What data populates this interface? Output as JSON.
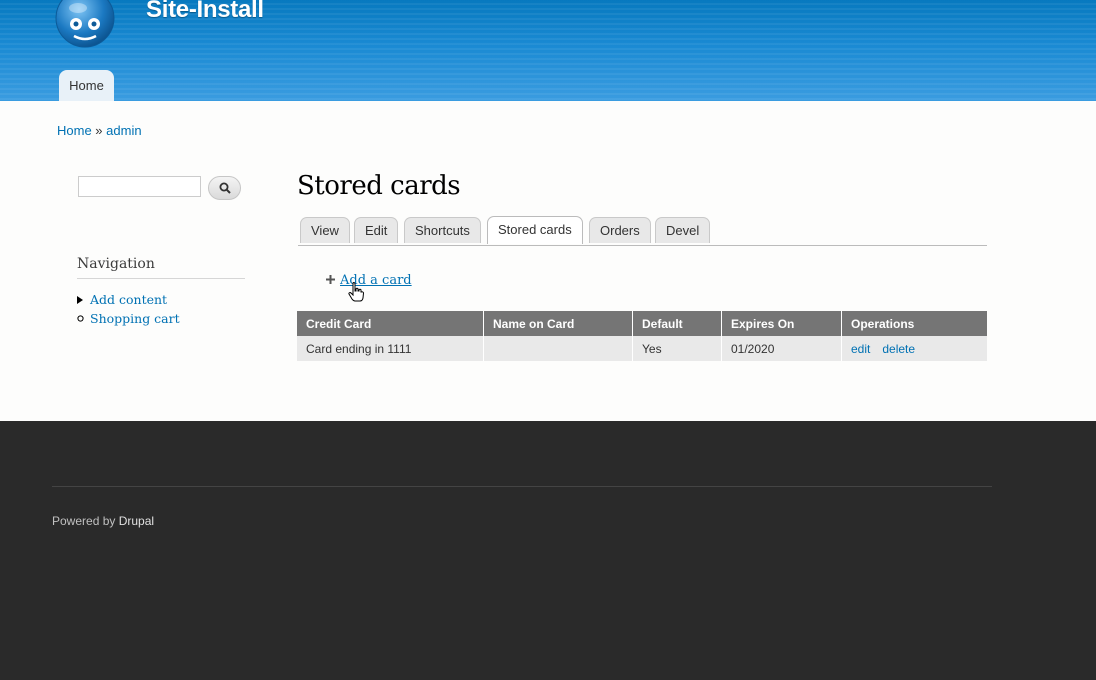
{
  "header": {
    "site_name": "Site-Install",
    "logo_icon": "drupal-drop-icon",
    "menu": [
      {
        "label": "Home"
      }
    ]
  },
  "breadcrumb": {
    "home": "Home",
    "separator": " » ",
    "current": "admin"
  },
  "sidebar": {
    "search": {
      "value": "",
      "button_icon": "search-icon"
    },
    "navigation": {
      "title": "Navigation",
      "items": [
        {
          "label": "Add content",
          "marker": "triangle-right"
        },
        {
          "label": "Shopping cart",
          "marker": "circle"
        }
      ]
    }
  },
  "main": {
    "title": "Stored cards",
    "tabs": [
      {
        "label": "View"
      },
      {
        "label": "Edit"
      },
      {
        "label": "Shortcuts"
      },
      {
        "label": "Stored cards",
        "active": true
      },
      {
        "label": "Orders"
      },
      {
        "label": "Devel"
      }
    ],
    "add_card_label": "Add a card",
    "table": {
      "columns": [
        "Credit Card",
        "Name on Card",
        "Default",
        "Expires On",
        "Operations"
      ],
      "rows": [
        {
          "credit_card": "Card ending in 1111",
          "name_on_card": "",
          "default": "Yes",
          "expires_on": "01/2020",
          "operations": [
            "edit",
            "delete"
          ]
        }
      ]
    }
  },
  "footer": {
    "powered_by": "Powered by ",
    "drupal_link": "Drupal"
  },
  "colors": {
    "header_blue": "#0779bf",
    "link": "#0071b3",
    "table_header": "#757575",
    "footer_bg": "#2a2a2a"
  }
}
